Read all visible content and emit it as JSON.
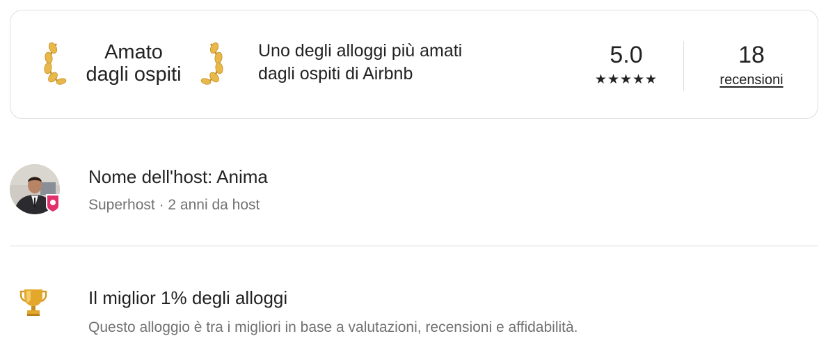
{
  "guest_favorite": {
    "badge_line1": "Amato",
    "badge_line2": "dagli ospiti",
    "description_line1": "Uno degli alloggi più amati",
    "description_line2": "dagli ospiti di Airbnb",
    "rating": "5.0",
    "stars": 5,
    "stars_text": "★★★★★",
    "reviews_count": "18",
    "reviews_label": "recensioni",
    "laurel_color": "#e8b84b"
  },
  "host": {
    "name": "Nome dell'host: Anima",
    "meta": "Superhost · 2 anni da host",
    "superhost_badge_color": "#e1306c"
  },
  "highlight": {
    "icon": "trophy-icon",
    "title": "Il miglior 1% degli alloggi",
    "description": "Questo alloggio è tra i migliori in base a valutazioni, recensioni e affidabilità.",
    "trophy_color": "#e3a82b"
  }
}
